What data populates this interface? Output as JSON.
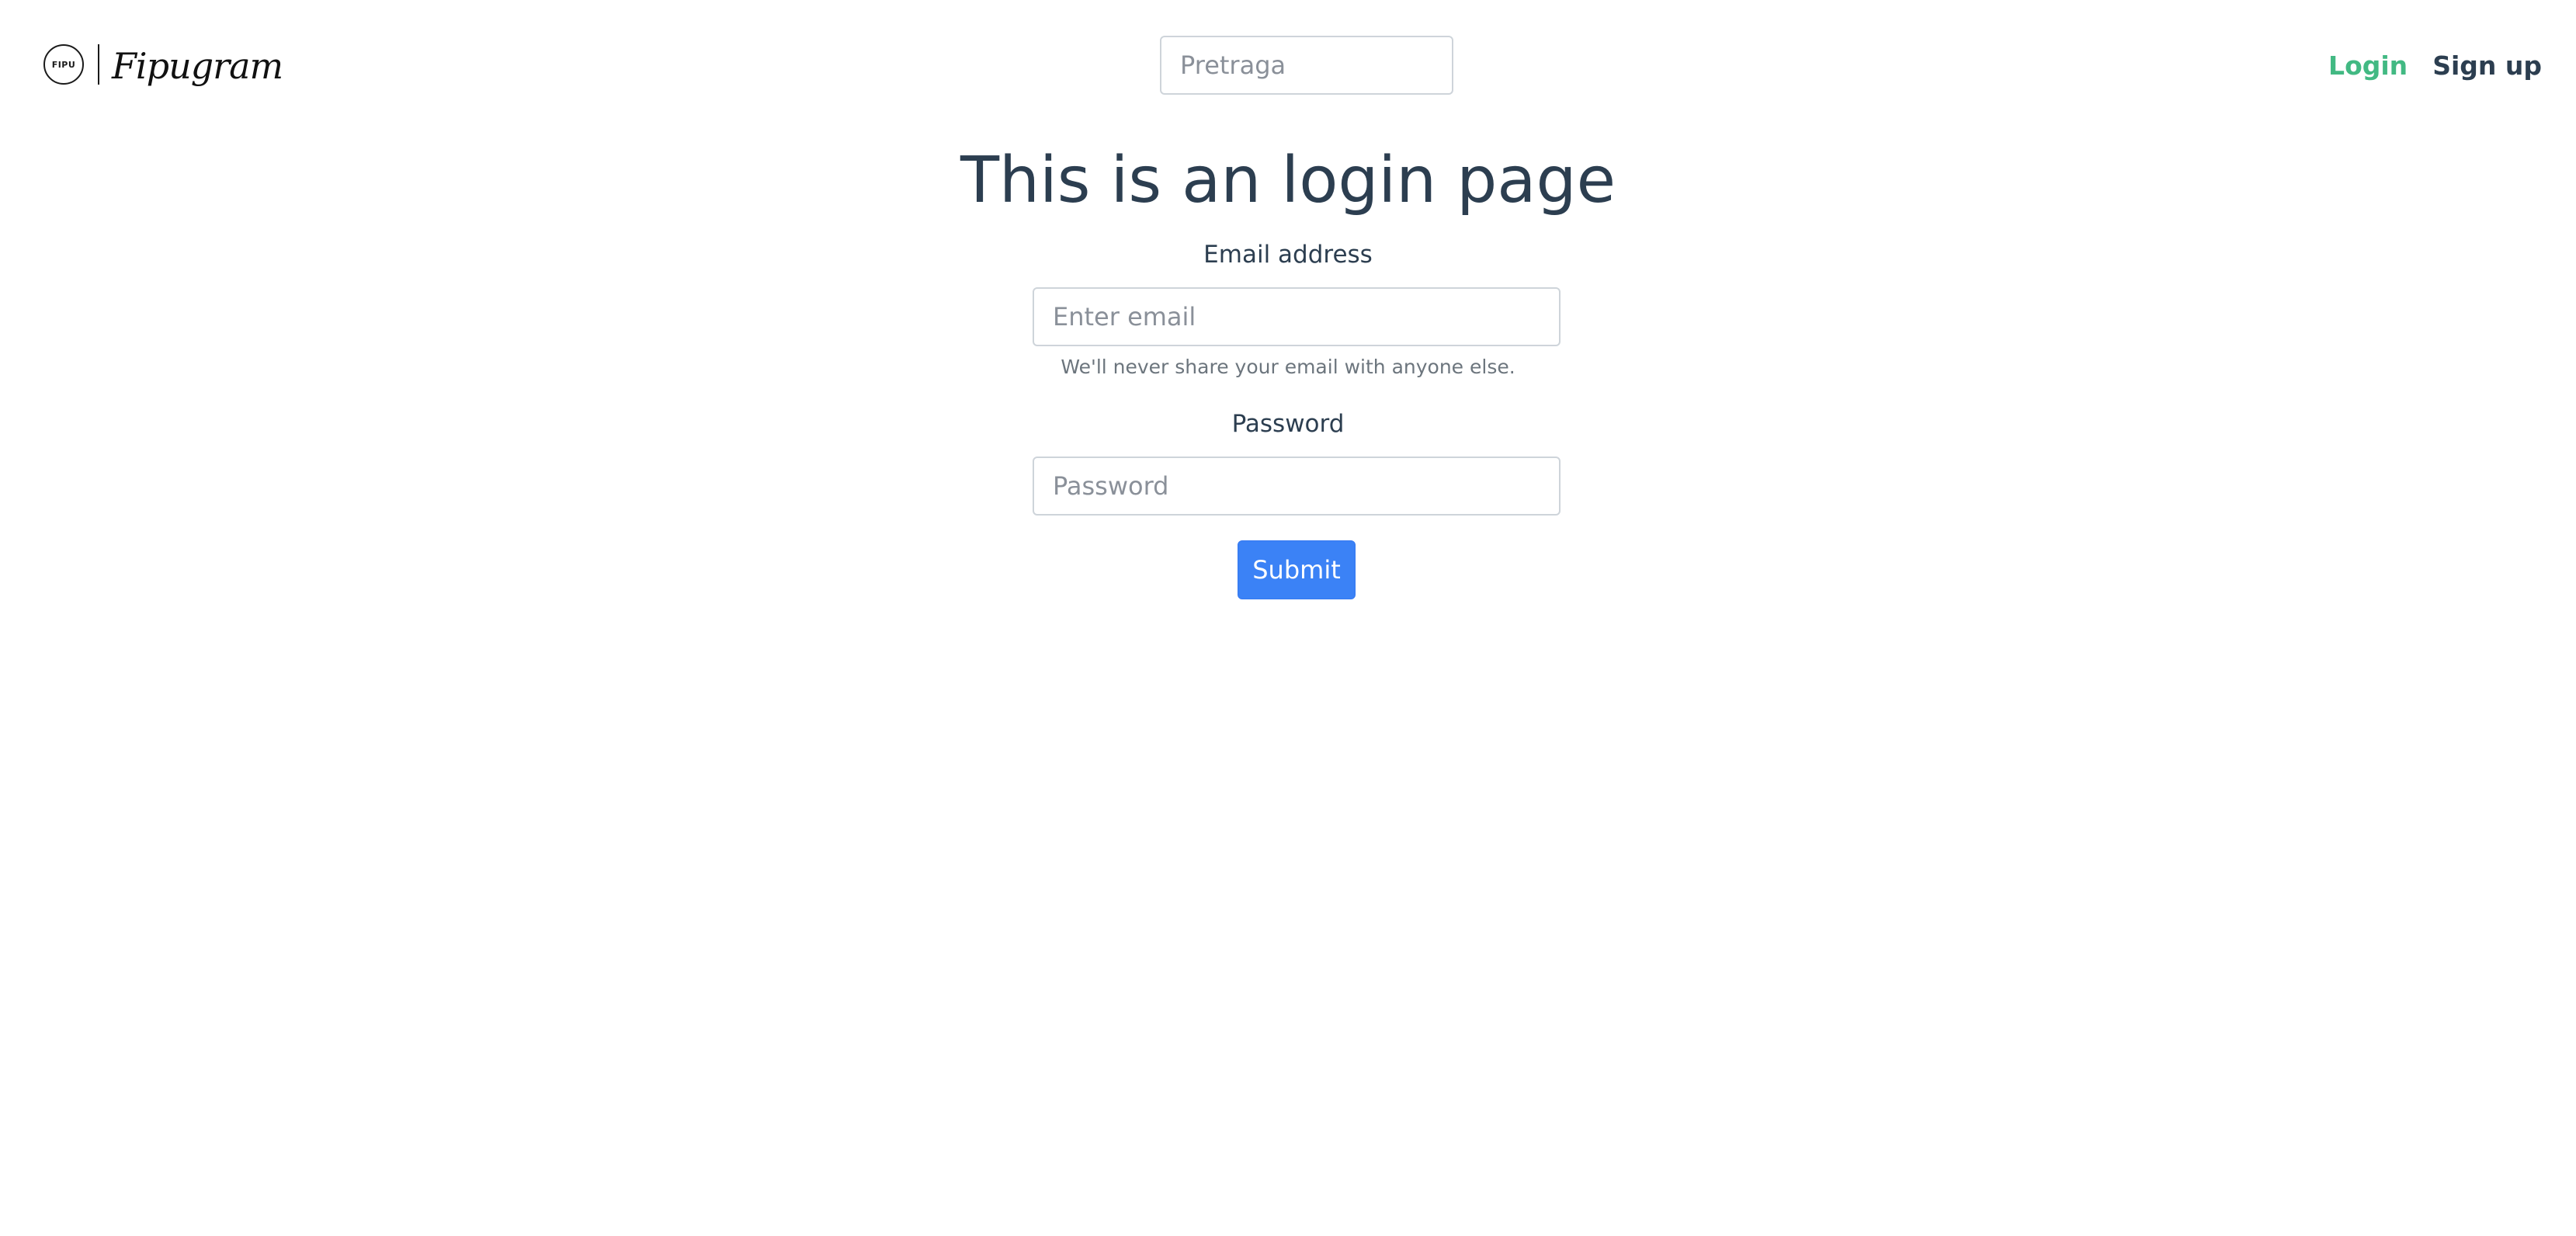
{
  "header": {
    "brand": {
      "badge_text": "FIPU",
      "wordmark": "Fipugram"
    },
    "search": {
      "placeholder": "Pretraga",
      "value": ""
    },
    "nav": {
      "login_label": "Login",
      "signup_label": "Sign up"
    },
    "colors": {
      "active_link": "#42b983",
      "text": "#2c3e50"
    }
  },
  "main": {
    "title": "This is an login page",
    "email": {
      "label": "Email address",
      "placeholder": "Enter email",
      "value": "",
      "help": "We'll never share your email with anyone else."
    },
    "password": {
      "label": "Password",
      "placeholder": "Password",
      "value": ""
    },
    "submit_label": "Submit",
    "colors": {
      "primary": "#3b82f6"
    }
  }
}
